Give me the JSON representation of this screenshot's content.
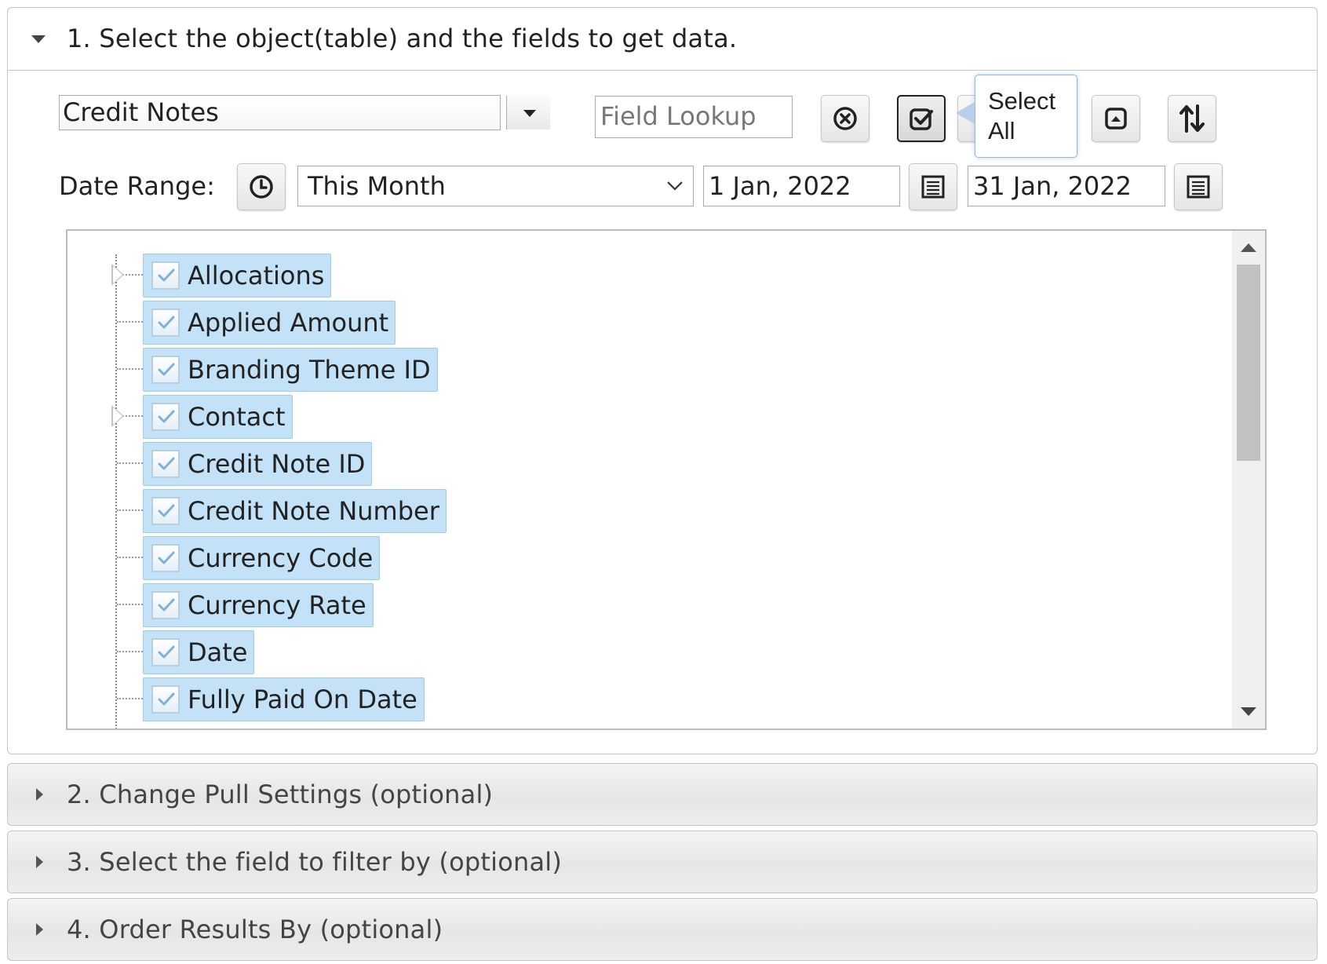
{
  "section1": {
    "title": "1. Select the object(table) and the fields to get data.",
    "object_select": {
      "value": "Credit Notes"
    },
    "field_lookup": {
      "placeholder": "Field Lookup",
      "value": ""
    },
    "tooltip": {
      "line1": "Select",
      "line2": "All"
    },
    "date_range": {
      "label": "Date Range:",
      "preset": "This Month",
      "from": "1 Jan, 2022",
      "to": "31 Jan, 2022"
    },
    "fields": [
      {
        "label": "Allocations",
        "expandable": true,
        "checked": true
      },
      {
        "label": "Applied Amount",
        "expandable": false,
        "checked": true
      },
      {
        "label": "Branding Theme ID",
        "expandable": false,
        "checked": true
      },
      {
        "label": "Contact",
        "expandable": true,
        "checked": true
      },
      {
        "label": "Credit Note ID",
        "expandable": false,
        "checked": true
      },
      {
        "label": "Credit Note Number",
        "expandable": false,
        "checked": true
      },
      {
        "label": "Currency Code",
        "expandable": false,
        "checked": true
      },
      {
        "label": "Currency Rate",
        "expandable": false,
        "checked": true
      },
      {
        "label": "Date",
        "expandable": false,
        "checked": true
      },
      {
        "label": "Fully Paid On Date",
        "expandable": false,
        "checked": true
      }
    ]
  },
  "sections": [
    {
      "title": "2. Change Pull Settings (optional)"
    },
    {
      "title": "3. Select the field to filter by (optional)"
    },
    {
      "title": "4. Order Results By (optional)"
    }
  ],
  "icons": {
    "clear": "circle-x-icon",
    "select_all": "check-square-icon",
    "collapse": "square-up-icon",
    "sort": "sort-arrows-icon",
    "clock": "clock-icon",
    "calendar": "list-calendar-icon"
  },
  "colors": {
    "node_bg": "#c3e2f7",
    "node_border": "#9fcbec",
    "tooltip_border": "#9ab6d8"
  }
}
